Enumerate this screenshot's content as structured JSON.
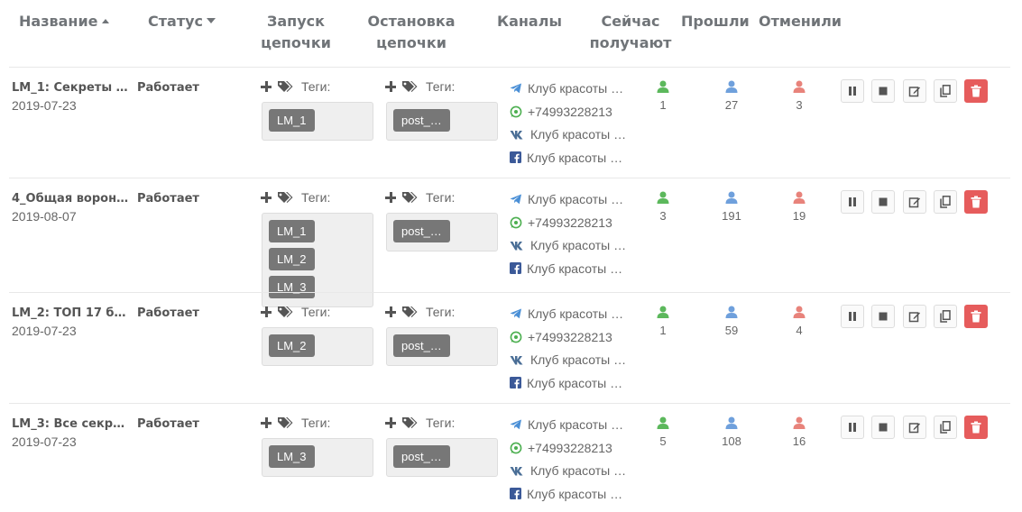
{
  "header": {
    "name": "Название",
    "status": "Статус",
    "start_line1": "Запуск",
    "start_line2": "цепочки",
    "stop_line1": "Остановка",
    "stop_line2": "цепочки",
    "channels": "Каналы",
    "now_line1": "Сейчас",
    "now_line2": "получают",
    "passed": "Прошли",
    "cancelled": "Отменили"
  },
  "tags_label": "Теги:",
  "channel_icons": [
    "telegram-icon",
    "whatsapp-icon",
    "vk-icon",
    "facebook-icon"
  ],
  "colors": {
    "green": "#5cb85c",
    "blue": "#6fa0dc",
    "red": "#e8837b",
    "danger": "#e65c5c",
    "chip": "#777777"
  },
  "rows": [
    {
      "name": "LM_1: Секреты N…",
      "date": "2019-07-23",
      "status": "Работает",
      "start_tags": [
        "LM_1"
      ],
      "stop_tags": [
        "post_…"
      ],
      "channels": [
        "Клуб красоты …",
        "+74993228213",
        "Клуб красоты …",
        "Клуб красоты …"
      ],
      "now": "1",
      "passed": "27",
      "cancelled": "3"
    },
    {
      "name": "4_Общая ворон…",
      "date": "2019-08-07",
      "status": "Работает",
      "start_tags": [
        "LM_1",
        "LM_2",
        "LM_3"
      ],
      "stop_tags": [
        "post_…"
      ],
      "channels": [
        "Клуб красоты …",
        "+74993228213",
        "Клуб красоты …",
        "Клуб красоты …"
      ],
      "now": "3",
      "passed": "191",
      "cancelled": "19"
    },
    {
      "name": "LM_2: ТОП 17 бь…",
      "date": "2019-07-23",
      "status": "Работает",
      "start_tags": [
        "LM_2"
      ],
      "stop_tags": [
        "post_…"
      ],
      "channels": [
        "Клуб красоты …",
        "+74993228213",
        "Клуб красоты …",
        "Клуб красоты …"
      ],
      "now": "1",
      "passed": "59",
      "cancelled": "4"
    },
    {
      "name": "LM_3: Все секрет…",
      "date": "2019-07-23",
      "status": "Работает",
      "start_tags": [
        "LM_3"
      ],
      "stop_tags": [
        "post_…"
      ],
      "channels": [
        "Клуб красоты …",
        "+74993228213",
        "Клуб красоты …",
        "Клуб красоты …"
      ],
      "now": "5",
      "passed": "108",
      "cancelled": "16"
    }
  ]
}
